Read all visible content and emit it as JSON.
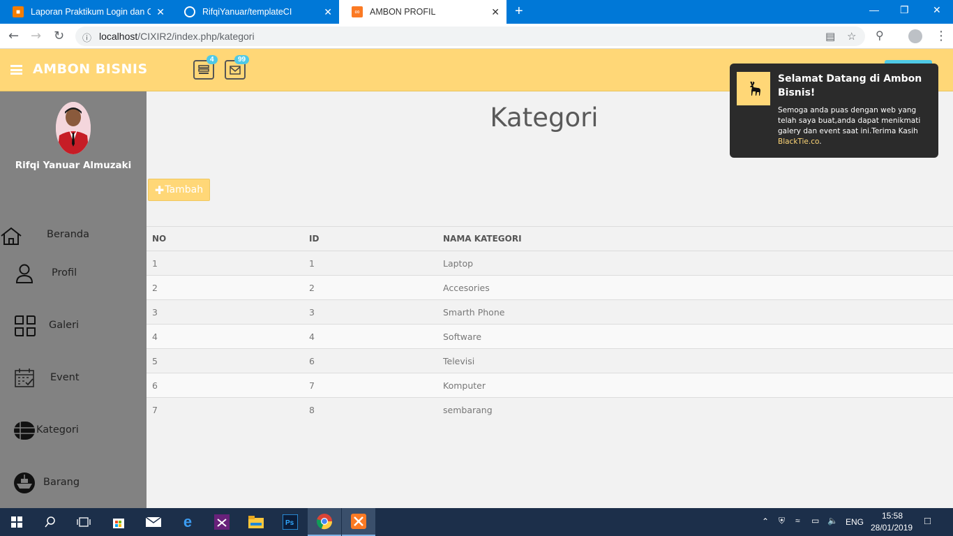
{
  "browser": {
    "tabs": [
      {
        "title": "Laporan Praktikum Login dan CR",
        "icon": "blogger-icon"
      },
      {
        "title": "RifqiYanuar/templateCI",
        "icon": "github-icon"
      },
      {
        "title": "AMBON PROFIL",
        "icon": "xampp-icon"
      }
    ],
    "url_host": "localhost",
    "url_path": "/CIXIR2/index.php/kategori"
  },
  "header": {
    "brand": "AMBON BISNIS",
    "tasks_badge": "4",
    "mail_badge": "99"
  },
  "sidebar": {
    "user_name": "Rifqi Yanuar Almuzaki",
    "items": [
      {
        "label": "Beranda",
        "icon": "home-icon"
      },
      {
        "label": "Profil",
        "icon": "user-icon"
      },
      {
        "label": "Galeri",
        "icon": "gallery-icon"
      },
      {
        "label": "Event",
        "icon": "calendar-icon"
      },
      {
        "label": "Kategori",
        "icon": "list-icon"
      },
      {
        "label": "Barang",
        "icon": "ship-icon"
      }
    ]
  },
  "main": {
    "title": "Kategori",
    "add_button": "Tambah",
    "table": {
      "headers": [
        "NO",
        "ID",
        "NAMA KATEGORI"
      ],
      "rows": [
        [
          "1",
          "1",
          "Laptop"
        ],
        [
          "2",
          "2",
          "Accesories"
        ],
        [
          "3",
          "3",
          "Smarth Phone"
        ],
        [
          "4",
          "4",
          "Software"
        ],
        [
          "5",
          "6",
          "Televisi"
        ],
        [
          "6",
          "7",
          "Komputer"
        ],
        [
          "7",
          "8",
          "sembarang"
        ]
      ]
    }
  },
  "notification": {
    "title": "Selamat Datang di Ambon Bisnis!",
    "body": "Semoga anda puas dengan web yang telah saya buat,anda dapat menikmati galery dan event saat ini.Terima Kasih ",
    "link": "BlackTie.co",
    "suffix": "."
  },
  "taskbar": {
    "lang": "ENG",
    "time": "15:58",
    "date": "28/01/2019"
  }
}
